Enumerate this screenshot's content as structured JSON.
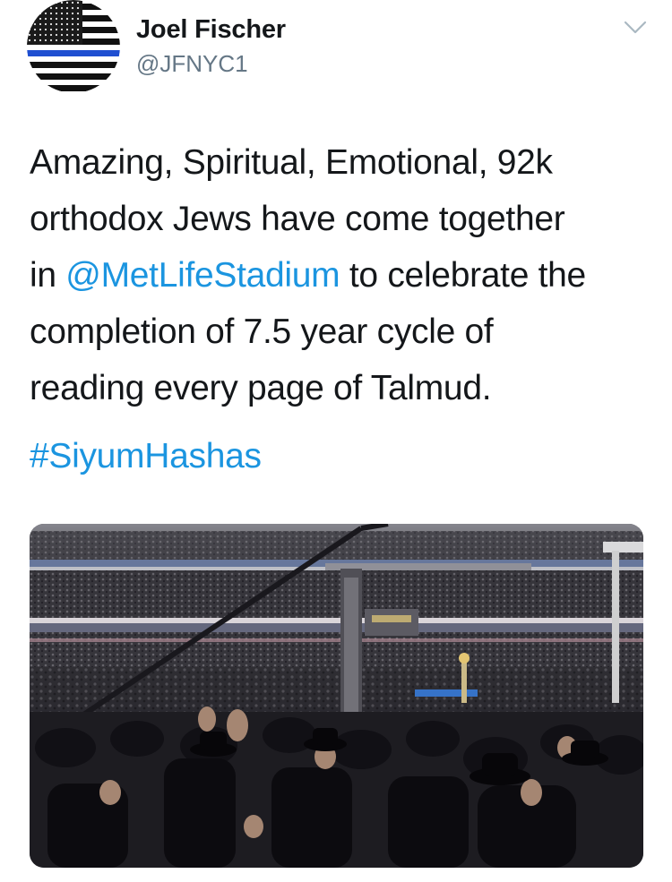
{
  "user": {
    "name": "Joel Fischer",
    "handle": "@JFNYC1",
    "avatar_icon": "thin-blue-line-flag-icon"
  },
  "menu": {
    "icon": "chevron-down-icon"
  },
  "tweet": {
    "line1": "Amazing, Spiritual, Emotional, 92k",
    "line2": "orthodox Jews have come together",
    "line3_prefix": "in ",
    "mention": "@MetLifeStadium",
    "line3_suffix": " to celebrate the",
    "line4": "completion of 7.5 year cycle of",
    "line5": "reading every page of Talmud.",
    "hashtag": "#SiyumHashas"
  },
  "colors": {
    "link": "#1b95e0",
    "name": "#14171a",
    "handle": "#657786",
    "flag_blue_line": "#1f4fd1"
  }
}
